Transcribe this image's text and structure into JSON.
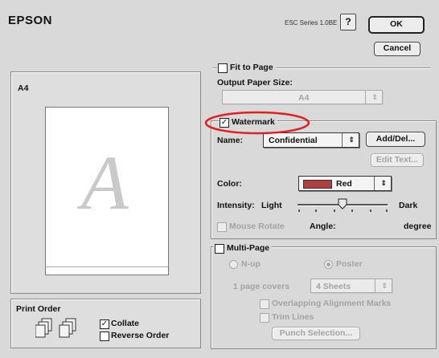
{
  "header": {
    "brand": "EPSON",
    "version": "ESC Series 1.0BE",
    "help_label": "?"
  },
  "buttons": {
    "ok": "OK",
    "cancel": "Cancel",
    "add_del": "Add/Del...",
    "edit_text": "Edit Text...",
    "punch_selection": "Punch Selection..."
  },
  "preview": {
    "paper_size": "A4",
    "watermark_glyph": "A"
  },
  "fit_to_page": {
    "label": "Fit to Page",
    "checked": false,
    "output_label": "Output Paper Size:",
    "output_value": "A4"
  },
  "watermark": {
    "label": "Watermark",
    "checked": true,
    "check_mark": "✓",
    "name_label": "Name:",
    "name_value": "Confidential",
    "color_label": "Color:",
    "color_value": "Red",
    "color_swatch": "#b04040",
    "intensity_label": "Intensity:",
    "intensity_light": "Light",
    "intensity_dark": "Dark",
    "intensity_level": 0.5,
    "mouse_rotate_label": "Mouse Rotate",
    "angle_label": "Angle:",
    "degree_label": "degree"
  },
  "multi_page": {
    "label": "Multi-Page",
    "checked": false,
    "nup_label": "N-up",
    "poster_label": "Poster",
    "poster_selected": true,
    "page_covers_label": "1 page covers",
    "sheets_value": "4 Sheets",
    "overlapping_label": "Overlapping Alignment Marks",
    "trim_lines_label": "Trim Lines"
  },
  "print_order": {
    "label": "Print Order",
    "collate_label": "Collate",
    "collate_checked": true,
    "reverse_label": "Reverse Order",
    "reverse_checked": false
  },
  "annotation": {
    "color": "#e0201c"
  }
}
